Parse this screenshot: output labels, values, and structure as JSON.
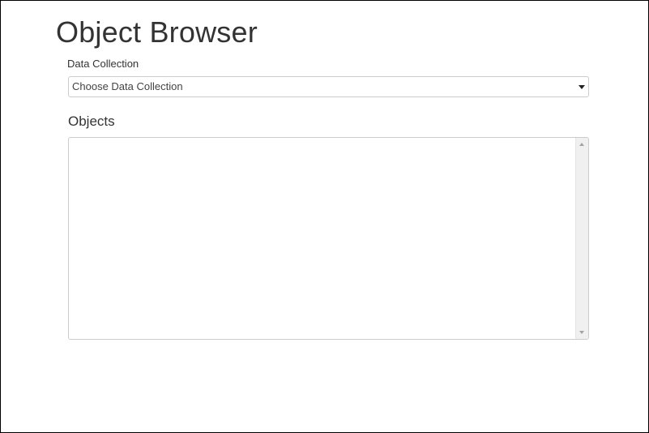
{
  "page": {
    "title": "Object Browser"
  },
  "data_collection": {
    "label": "Data Collection",
    "selected": "Choose Data Collection"
  },
  "objects": {
    "heading": "Objects",
    "items": []
  },
  "icons": {
    "select_arrow": "caret-down-icon",
    "scroll_up": "scroll-up-arrow-icon",
    "scroll_down": "scroll-down-arrow-icon"
  },
  "colors": {
    "border": "#cccccc",
    "text": "#333333",
    "scrollbar_track": "#f0f0f0",
    "window_border": "#000000"
  }
}
